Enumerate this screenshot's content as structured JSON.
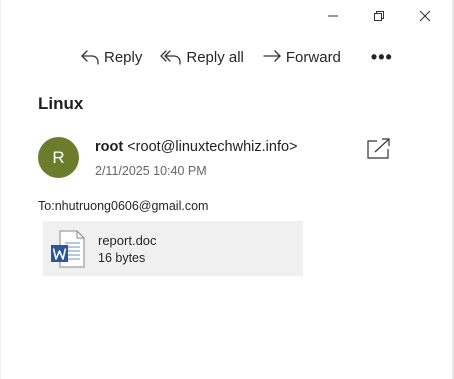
{
  "window": {
    "minimize_icon": "minimize-icon",
    "restore_icon": "restore-icon",
    "close_icon": "close-icon"
  },
  "toolbar": {
    "reply_label": "Reply",
    "reply_all_label": "Reply all",
    "forward_label": "Forward",
    "more_label": "•••"
  },
  "message": {
    "subject": "Linux",
    "avatar_initial": "R",
    "avatar_color": "#6b7d2a",
    "sender_name": "root",
    "sender_email": "<root@linuxtechwhiz.info>",
    "date": "2/11/2025 10:40 PM",
    "to_label": "To:",
    "to_address": "nhutruong0606@gmail.com"
  },
  "attachment": {
    "file_name": "report.doc",
    "file_size": "16 bytes",
    "icon": "word-document-icon",
    "icon_color": "#2b579a"
  }
}
